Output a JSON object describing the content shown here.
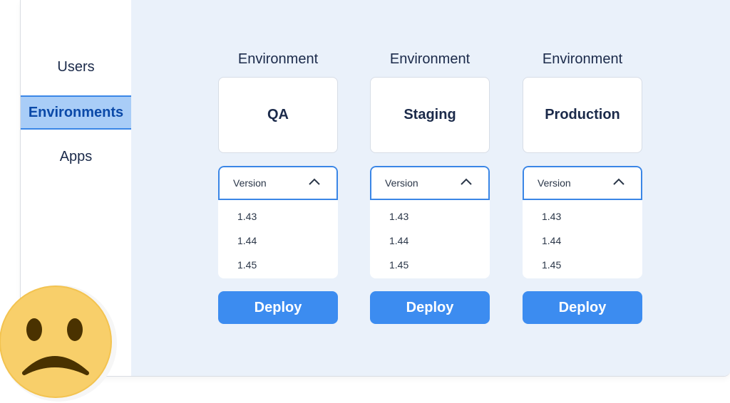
{
  "sidebar": {
    "items": [
      {
        "label": "Users"
      },
      {
        "label": "Environments",
        "active": true
      },
      {
        "label": "Apps"
      }
    ]
  },
  "colors": {
    "accent": "#3a86e6",
    "button": "#3c8cf0",
    "active_bg": "#a9cdf7",
    "main_bg": "#eaf1fa",
    "emoji_yellow": "#f8cf6a"
  },
  "environments": [
    {
      "heading": "Environment",
      "name": "QA",
      "version_label": "Version",
      "versions": [
        "1.43",
        "1.44",
        "1.45"
      ],
      "deploy_label": "Deploy"
    },
    {
      "heading": "Environment",
      "name": "Staging",
      "version_label": "Version",
      "versions": [
        "1.43",
        "1.44",
        "1.45"
      ],
      "deploy_label": "Deploy"
    },
    {
      "heading": "Environment",
      "name": "Production",
      "version_label": "Version",
      "versions": [
        "1.43",
        "1.44",
        "1.45"
      ],
      "deploy_label": "Deploy"
    }
  ],
  "overlay": {
    "icon": "sad-face-icon"
  }
}
